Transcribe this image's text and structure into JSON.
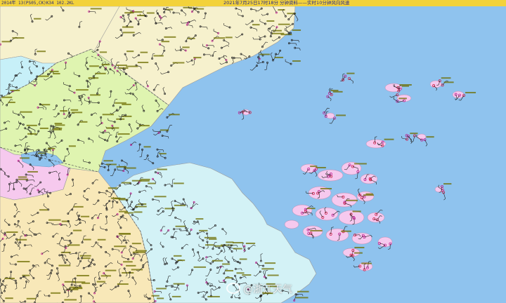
{
  "header": {
    "left_text": "2014年 13(PS05,CK)K34 102.2KL",
    "title": "2021年7月25日17时18分 分钟资料——实时10分钟风向风速"
  },
  "watermark": {
    "text": "@浙江天气"
  },
  "colors": {
    "sea": "#8fc3ee",
    "header": "#f3d23a",
    "land_north": "#f6f1cd",
    "land_shandong": "#dff4b0",
    "land_jiangsu": "#f8e8b8",
    "land_zhejiang": "#d3f2f6",
    "land_anhui": "#f6c9ee",
    "land_west": "#c7f0f8",
    "wind_barb": "#222222",
    "station_magenta": "#c0148f",
    "station_red": "#d0103a",
    "label_olive": "#6e6e00"
  }
}
